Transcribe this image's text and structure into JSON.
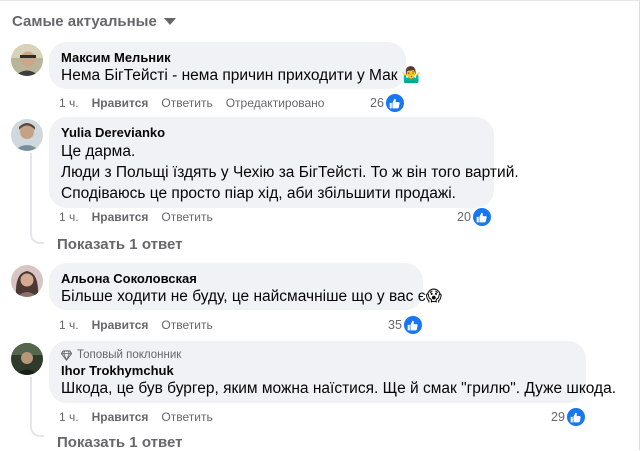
{
  "sort": {
    "label": "Самые актуальные",
    "icon": "caret-down-icon"
  },
  "comments": [
    {
      "author": "Максим Мельник",
      "lines": [
        "Нема БігТейсті - нема причин приходити у Мак 🤷‍♂️"
      ],
      "time": "1 ч.",
      "like_action": "Нравится",
      "reply_action": "Ответить",
      "edited": "Отредактировано",
      "reactions": "26"
    },
    {
      "author": "Yulia Derevianko",
      "lines": [
        "Це дарма.",
        "Люди з Польщі їздять у Чехію за БігТейсті. То ж він того вартий.",
        "Сподіваюсь це просто піар хід, аби збільшити продажі."
      ],
      "time": "1 ч.",
      "like_action": "Нравится",
      "reply_action": "Ответить",
      "reactions": "20",
      "view_replies": "Показать 1 ответ"
    },
    {
      "author": "Альона Соколовская",
      "lines": [
        "Більше ходити не буду, це найсмачніше що у вас є😱"
      ],
      "time": "1 ч.",
      "like_action": "Нравится",
      "reply_action": "Ответить",
      "reactions": "35"
    },
    {
      "badge": "Топовый поклонник",
      "author": "Ihor Trokhymchuk",
      "lines": [
        "Шкода, це був бургер, яким можна наїстися. Ще й смак \"грилю\". Дуже шкода."
      ],
      "time": "1 ч.",
      "like_action": "Нравится",
      "reply_action": "Ответить",
      "reactions": "29",
      "view_replies": "Показать 1 ответ"
    }
  ],
  "colors": {
    "bubble": "#f0f2f5",
    "secondary_text": "#65676b",
    "like_blue": "#1877f2",
    "thread_line": "#e4e6eb"
  }
}
